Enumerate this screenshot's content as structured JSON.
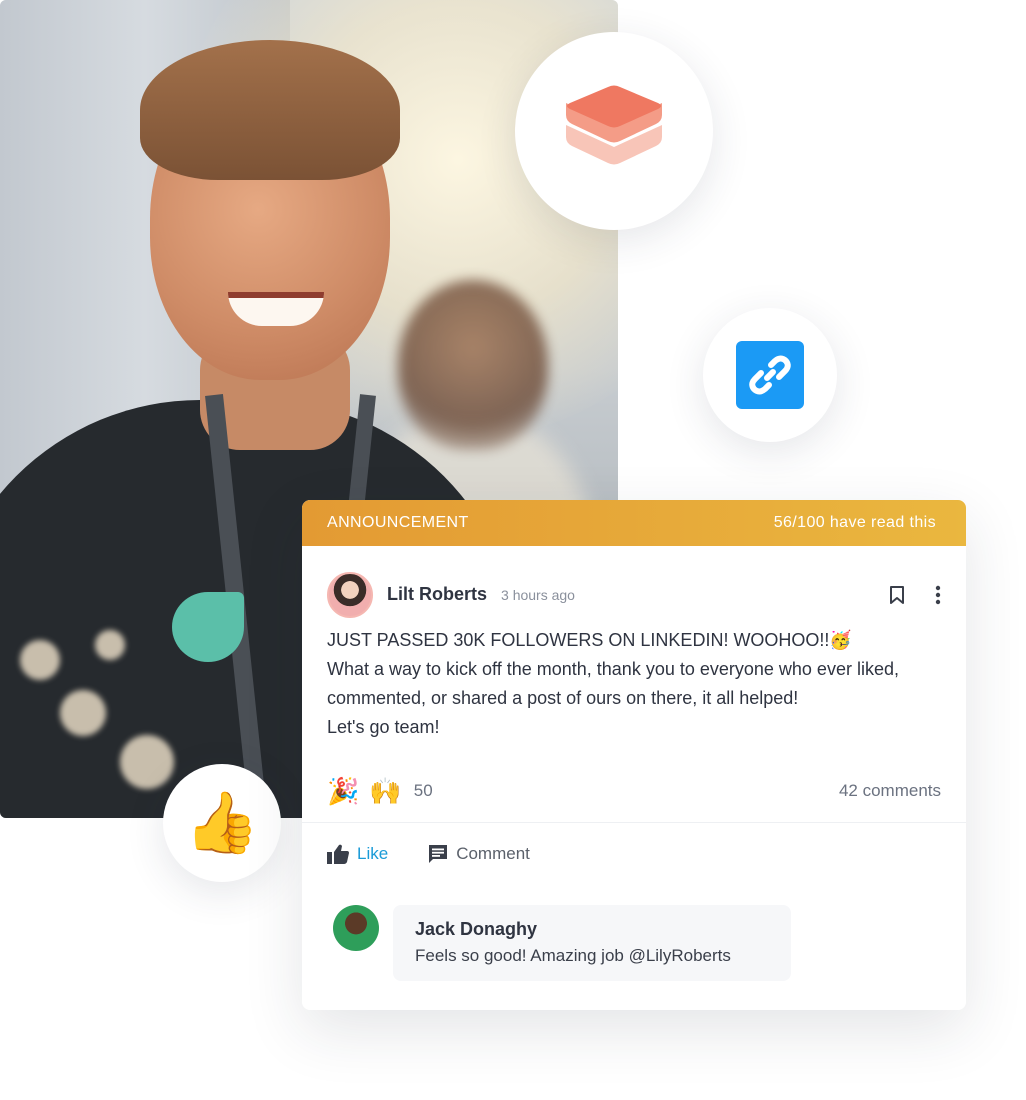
{
  "colors": {
    "announcement_start": "#e39a33",
    "announcement_end": "#eab73f",
    "link_tile": "#1b9af5",
    "like_active": "#1a9bd7",
    "stack_icon": "#ef7861"
  },
  "icons": {
    "stack": "layers-stack-icon",
    "link": "link-chain-icon",
    "thumb": "thumbs-up-emoji",
    "bookmark": "bookmark-icon",
    "more": "more-vertical-icon",
    "like": "thumbs-up-icon",
    "comment": "comment-icon"
  },
  "floating": {
    "thumb_emoji": "👍"
  },
  "announcement": {
    "label": "ANNOUNCEMENT",
    "read_status": "56/100 have read this"
  },
  "post": {
    "author": "Lilt Roberts",
    "time": "3 hours ago",
    "line1": "JUST PASSED 30K FOLLOWERS ON LINKEDIN! WOOHOO!!🥳",
    "line2": "What a way to kick off the month, thank you to everyone who ever liked, commented, or shared a post of ours on there, it all helped!",
    "line3": "Let's go team!"
  },
  "reactions": {
    "emoji1": "🎉",
    "emoji2": "🙌",
    "count": "50",
    "comments": "42 comments"
  },
  "actions": {
    "like": "Like",
    "comment": "Comment"
  },
  "comment": {
    "author": "Jack Donaghy",
    "text": "Feels so good! Amazing job @LilyRoberts"
  }
}
